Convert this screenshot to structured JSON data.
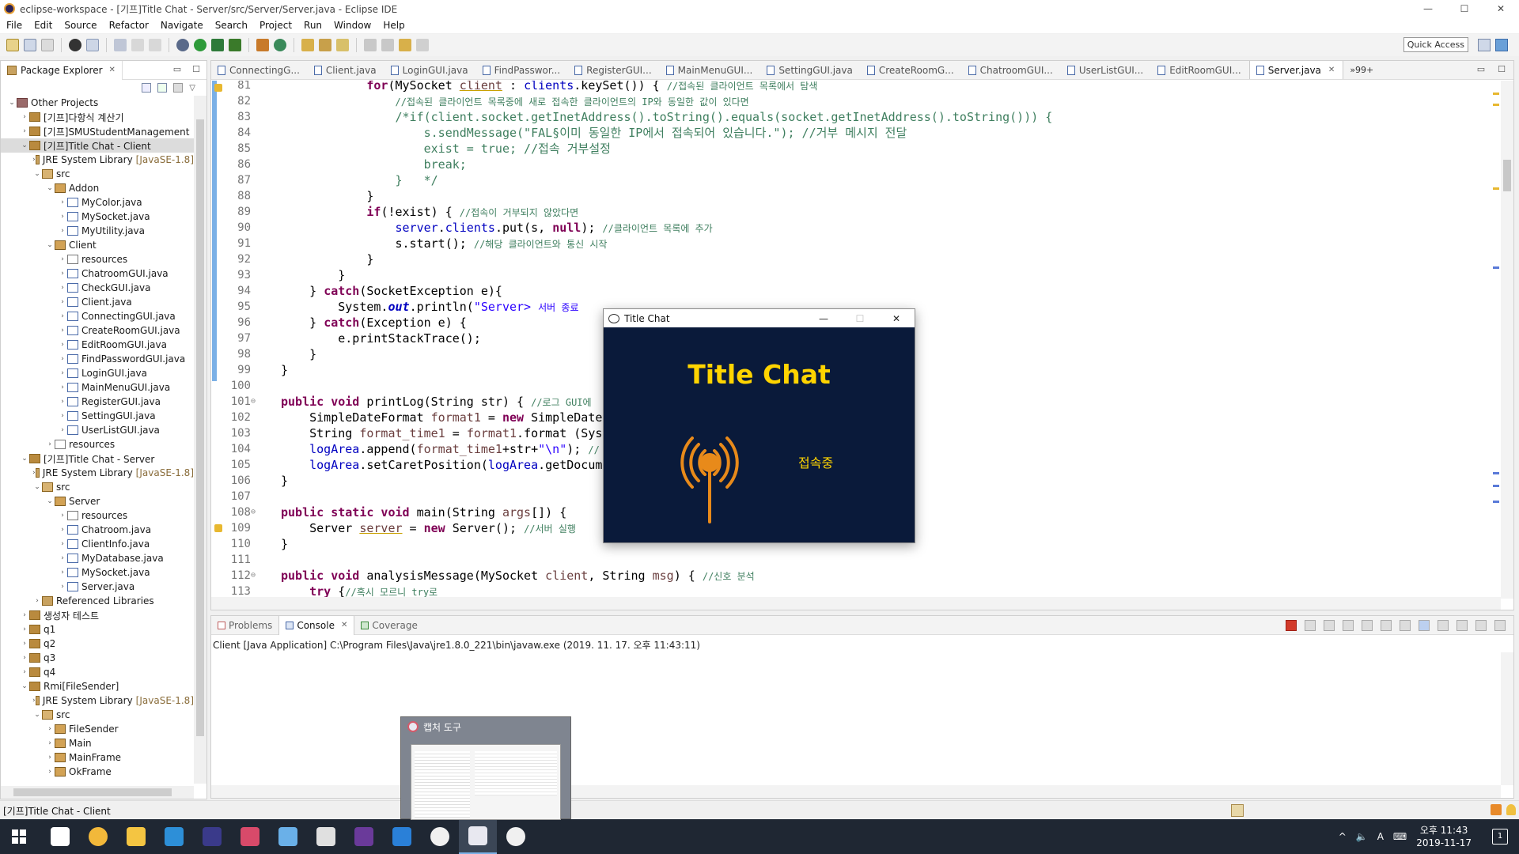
{
  "window": {
    "title": "eclipse-workspace - [기프]Title Chat - Server/src/Server/Server.java - Eclipse IDE",
    "controls": [
      "—",
      "☐",
      "✕"
    ]
  },
  "menu": [
    "File",
    "Edit",
    "Source",
    "Refactor",
    "Navigate",
    "Search",
    "Project",
    "Run",
    "Window",
    "Help"
  ],
  "toolbar": {
    "quick_access": "Quick Access"
  },
  "package_explorer": {
    "tab_label": "Package Explorer",
    "tree": [
      {
        "depth": 0,
        "arrow": "⌄",
        "icon": "wset",
        "label": "Other Projects"
      },
      {
        "depth": 1,
        "arrow": "›",
        "icon": "proj",
        "label": "[기프]다항식 계산기"
      },
      {
        "depth": 1,
        "arrow": "›",
        "icon": "proj",
        "label": "[기프]SMUStudentManagement"
      },
      {
        "depth": 1,
        "arrow": "⌄",
        "icon": "proj",
        "label": "[기프]Title Chat - Client",
        "selected": true
      },
      {
        "depth": 2,
        "arrow": "›",
        "icon": "lib",
        "label": "JRE System Library",
        "suffix": "[JavaSE-1.8]"
      },
      {
        "depth": 2,
        "arrow": "⌄",
        "icon": "src",
        "label": "src"
      },
      {
        "depth": 3,
        "arrow": "⌄",
        "icon": "pkg",
        "label": "Addon"
      },
      {
        "depth": 4,
        "arrow": "›",
        "icon": "java",
        "label": "MyColor.java"
      },
      {
        "depth": 4,
        "arrow": "›",
        "icon": "java",
        "label": "MySocket.java"
      },
      {
        "depth": 4,
        "arrow": "›",
        "icon": "java",
        "label": "MyUtility.java"
      },
      {
        "depth": 3,
        "arrow": "⌄",
        "icon": "pkg",
        "label": "Client"
      },
      {
        "depth": 4,
        "arrow": "›",
        "icon": "res",
        "label": "resources"
      },
      {
        "depth": 4,
        "arrow": "›",
        "icon": "java",
        "label": "ChatroomGUI.java"
      },
      {
        "depth": 4,
        "arrow": "›",
        "icon": "java",
        "label": "CheckGUI.java"
      },
      {
        "depth": 4,
        "arrow": "›",
        "icon": "java",
        "label": "Client.java"
      },
      {
        "depth": 4,
        "arrow": "›",
        "icon": "java",
        "label": "ConnectingGUI.java"
      },
      {
        "depth": 4,
        "arrow": "›",
        "icon": "java",
        "label": "CreateRoomGUI.java"
      },
      {
        "depth": 4,
        "arrow": "›",
        "icon": "java",
        "label": "EditRoomGUI.java"
      },
      {
        "depth": 4,
        "arrow": "›",
        "icon": "java",
        "label": "FindPasswordGUI.java"
      },
      {
        "depth": 4,
        "arrow": "›",
        "icon": "java",
        "label": "LoginGUI.java"
      },
      {
        "depth": 4,
        "arrow": "›",
        "icon": "java",
        "label": "MainMenuGUI.java"
      },
      {
        "depth": 4,
        "arrow": "›",
        "icon": "java",
        "label": "RegisterGUI.java"
      },
      {
        "depth": 4,
        "arrow": "›",
        "icon": "java",
        "label": "SettingGUI.java"
      },
      {
        "depth": 4,
        "arrow": "›",
        "icon": "java",
        "label": "UserListGUI.java"
      },
      {
        "depth": 3,
        "arrow": "›",
        "icon": "res",
        "label": "resources"
      },
      {
        "depth": 1,
        "arrow": "⌄",
        "icon": "proj",
        "label": "[기프]Title Chat - Server"
      },
      {
        "depth": 2,
        "arrow": "›",
        "icon": "lib",
        "label": "JRE System Library",
        "suffix": "[JavaSE-1.8]"
      },
      {
        "depth": 2,
        "arrow": "⌄",
        "icon": "src",
        "label": "src"
      },
      {
        "depth": 3,
        "arrow": "⌄",
        "icon": "pkg",
        "label": "Server"
      },
      {
        "depth": 4,
        "arrow": "›",
        "icon": "res",
        "label": "resources"
      },
      {
        "depth": 4,
        "arrow": "›",
        "icon": "java",
        "label": "Chatroom.java"
      },
      {
        "depth": 4,
        "arrow": "›",
        "icon": "java",
        "label": "ClientInfo.java"
      },
      {
        "depth": 4,
        "arrow": "›",
        "icon": "java",
        "label": "MyDatabase.java"
      },
      {
        "depth": 4,
        "arrow": "›",
        "icon": "java",
        "label": "MySocket.java"
      },
      {
        "depth": 4,
        "arrow": "›",
        "icon": "java",
        "label": "Server.java"
      },
      {
        "depth": 2,
        "arrow": "›",
        "icon": "lib",
        "label": "Referenced Libraries"
      },
      {
        "depth": 1,
        "arrow": "›",
        "icon": "proj",
        "label": "생성자 테스트"
      },
      {
        "depth": 1,
        "arrow": "›",
        "icon": "proj",
        "label": "q1"
      },
      {
        "depth": 1,
        "arrow": "›",
        "icon": "proj",
        "label": "q2"
      },
      {
        "depth": 1,
        "arrow": "›",
        "icon": "proj",
        "label": "q3"
      },
      {
        "depth": 1,
        "arrow": "›",
        "icon": "proj",
        "label": "q4"
      },
      {
        "depth": 1,
        "arrow": "⌄",
        "icon": "proj",
        "label": "Rmi[FileSender]"
      },
      {
        "depth": 2,
        "arrow": "›",
        "icon": "lib",
        "label": "JRE System Library",
        "suffix": "[JavaSE-1.8]"
      },
      {
        "depth": 2,
        "arrow": "⌄",
        "icon": "src",
        "label": "src"
      },
      {
        "depth": 3,
        "arrow": "›",
        "icon": "pkg",
        "label": "FileSender"
      },
      {
        "depth": 3,
        "arrow": "›",
        "icon": "pkg",
        "label": "Main"
      },
      {
        "depth": 3,
        "arrow": "›",
        "icon": "pkg",
        "label": "MainFrame"
      },
      {
        "depth": 3,
        "arrow": "›",
        "icon": "pkg",
        "label": "OkFrame"
      }
    ]
  },
  "editor": {
    "tabs": [
      {
        "label": "ConnectingG..."
      },
      {
        "label": "Client.java"
      },
      {
        "label": "LoginGUI.java"
      },
      {
        "label": "FindPasswor..."
      },
      {
        "label": "RegisterGUI..."
      },
      {
        "label": "MainMenuGUI..."
      },
      {
        "label": "SettingGUI.java"
      },
      {
        "label": "CreateRoomG..."
      },
      {
        "label": "ChatroomGUI..."
      },
      {
        "label": "UserListGUI..."
      },
      {
        "label": "EditRoomGUI..."
      },
      {
        "label": "Server.java",
        "active": true
      }
    ],
    "more_tabs": "»99+",
    "lines": [
      {
        "n": "81",
        "html": "            <span class=\"kw\">for</span>(MySocket <span class=\"loc\">client</span> : <span class=\"fd\">clients</span>.keySet()) { <span class=\"cm\">//접속된 클라이언트 목록에서 탐색</span>"
      },
      {
        "n": "82",
        "html": "                <span class=\"cm\">//접속된 클라이언트 목록중에 새로 접속한 클라이언트의 IP와 동일한 값이 있다면</span>"
      },
      {
        "n": "83",
        "html": "                <span class=\"cmb\">/*if(client.socket.getInetAddress().toString().equals(socket.getInetAddress().toString())) {</span>"
      },
      {
        "n": "84",
        "html": "                    <span class=\"cmb\">s.sendMessage(\"FAL§이미 동일한 IP에서 접속되어 있습니다.\"); //거부 메시지 전달</span>"
      },
      {
        "n": "85",
        "html": "                    <span class=\"cmb\">exist = true; //접속 거부설정</span>"
      },
      {
        "n": "86",
        "html": "                    <span class=\"cmb\">break;</span>"
      },
      {
        "n": "87",
        "html": "                <span class=\"cmb\">}   */</span>"
      },
      {
        "n": "88",
        "html": "            }"
      },
      {
        "n": "89",
        "html": "            <span class=\"kw\">if</span>(!exist) { <span class=\"cm\">//접속이 거부되지 않았다면</span>"
      },
      {
        "n": "90",
        "html": "                <span class=\"fd\">server</span>.<span class=\"fd\">clients</span>.put(s, <span class=\"kw\">null</span>); <span class=\"cm\">//클라이언트 목록에 추가</span>"
      },
      {
        "n": "91",
        "html": "                s.start(); <span class=\"cm\">//해당 클라이언트와 통신 시작</span>"
      },
      {
        "n": "92",
        "html": "            }"
      },
      {
        "n": "93",
        "html": "        }"
      },
      {
        "n": "94",
        "html": "    } <span class=\"kw\">catch</span>(SocketException e){"
      },
      {
        "n": "95",
        "html": "        System.<span class=\"it\">out</span>.println(<span class=\"st\">\"Server> </span><span class=\"cm\" style=\"color:#2a00ff\">서버 종료</span>"
      },
      {
        "n": "96",
        "html": "    } <span class=\"kw\">catch</span>(Exception e) {"
      },
      {
        "n": "97",
        "html": "        e.printStackTrace();"
      },
      {
        "n": "98",
        "html": "    }"
      },
      {
        "n": "99",
        "html": "}"
      },
      {
        "n": "100",
        "html": ""
      },
      {
        "n": "101",
        "fold": "⊖",
        "html": "<span class=\"kw\">public void</span> printLog(String str) { <span class=\"cm\">//로그 GUI에</span>"
      },
      {
        "n": "102",
        "html": "    SimpleDateFormat <span class=\"loc\" style=\"text-decoration:none;color:#6a3e3e\">format1</span> = <span class=\"kw\">new</span> SimpleDate"
      },
      {
        "n": "103",
        "html": "    String <span style=\"color:#6a3e3e\">format_time1</span> = <span style=\"color:#6a3e3e\">format1</span>.format (Syst"
      },
      {
        "n": "104",
        "html": "    <span class=\"fd\">logArea</span>.append(<span style=\"color:#6a3e3e\">format_time1</span>+str+<span class=\"st\">\"\\n\"</span>); <span class=\"cm\">//</span>"
      },
      {
        "n": "105",
        "html": "    <span class=\"fd\">logArea</span>.setCaretPosition(<span class=\"fd\">logArea</span>.getDocum"
      },
      {
        "n": "106",
        "html": "}"
      },
      {
        "n": "107",
        "html": ""
      },
      {
        "n": "108",
        "fold": "⊖",
        "html": "<span class=\"kw\">public static void</span> main(String <span style=\"color:#6a3e3e\">args</span>[]) {"
      },
      {
        "n": "109",
        "warn": true,
        "html": "    Server <span class=\"loc\">server</span> = <span class=\"kw\">new</span> Server(); <span class=\"cm\">//서버 실행</span>"
      },
      {
        "n": "110",
        "html": "}"
      },
      {
        "n": "111",
        "html": ""
      },
      {
        "n": "112",
        "fold": "⊖",
        "html": "<span class=\"kw\">public void</span> analysisMessage(MySocket <span style=\"color:#6a3e3e\">client</span>, String <span style=\"color:#6a3e3e\">msg</span>) { <span class=\"cm\">//신호 분석</span>"
      },
      {
        "n": "113",
        "html": "    <span class=\"kw\">try</span> {<span class=\"cm\">//혹시 모르니 try로</span>"
      }
    ]
  },
  "console": {
    "tabs": [
      {
        "label": "Problems"
      },
      {
        "label": "Console",
        "active": true
      },
      {
        "label": "Coverage"
      }
    ],
    "header": "Client [Java Application] C:\\Program Files\\Java\\jre1.8.0_221\\bin\\javaw.exe (2019. 11. 17. 오후 11:43:11)"
  },
  "status_bar": {
    "text": "[기프]Title Chat - Client"
  },
  "chat_window": {
    "title": "Title Chat",
    "heading": "Title Chat",
    "status": "접속중",
    "bg_color": "#0a1a3a",
    "accent_color": "#ffd400",
    "antenna_color": "#e88a1a"
  },
  "taskbar": {
    "icons": [
      "explorer-store-icon",
      "chrome-icon",
      "file-explorer-icon",
      "edge-icon",
      "eclipse-icon",
      "kakaotalk-badge-icon",
      "notepad-icon",
      "java-app-icon",
      "visual-studio-icon",
      "vs-code-icon",
      "chat-app-icon",
      "capture-tool-icon",
      "chat-app-icon-2"
    ],
    "tray_symbols": [
      "^",
      "🔈",
      "A",
      "⌨"
    ],
    "clock_time": "오후 11:43",
    "clock_date": "2019-11-17",
    "notification_count": "1"
  },
  "capture_popup": {
    "title": "캡처 도구"
  }
}
